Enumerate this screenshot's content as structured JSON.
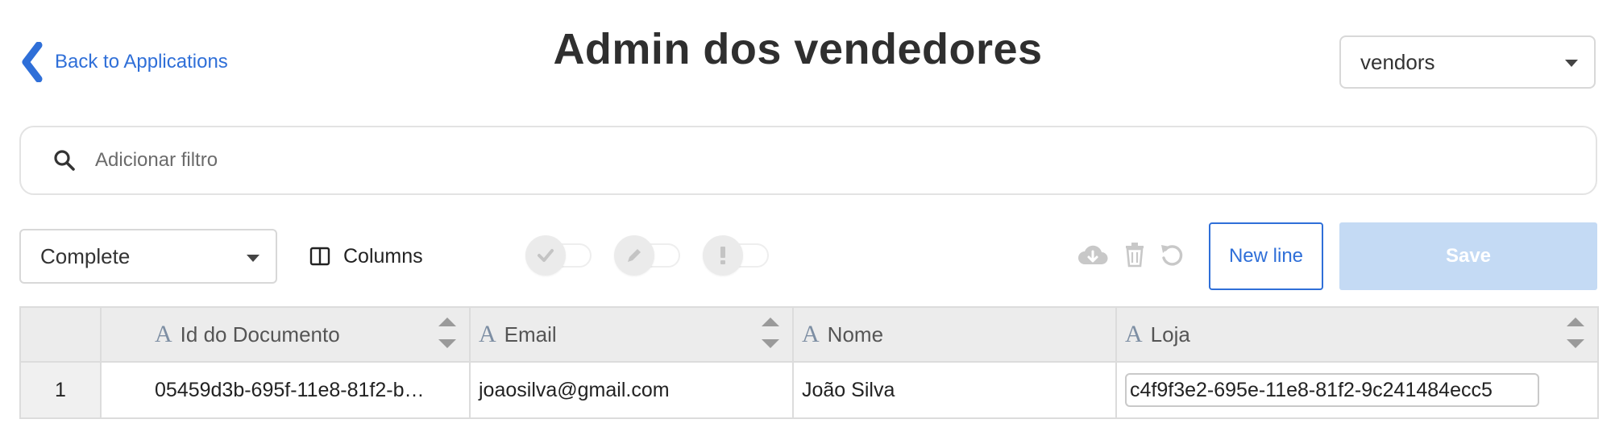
{
  "header": {
    "back_label": "Back to Applications",
    "title": "Admin dos vendedores",
    "app_select": {
      "value": "vendors"
    }
  },
  "filter": {
    "placeholder": "Adicionar filtro",
    "value": ""
  },
  "toolbar": {
    "view_select": {
      "value": "Complete"
    },
    "columns_label": "Columns",
    "toggles": [
      {
        "icon": "check-icon",
        "enabled": false
      },
      {
        "icon": "pencil-icon",
        "enabled": false
      },
      {
        "icon": "exclamation-icon",
        "enabled": false
      }
    ],
    "actions": [
      "cloud-download-icon",
      "trash-icon",
      "undo-icon"
    ],
    "new_line_label": "New line",
    "save_label": "Save"
  },
  "table": {
    "columns": [
      {
        "label": "Id do Documento",
        "type_icon": "A"
      },
      {
        "label": "Email",
        "type_icon": "A"
      },
      {
        "label": "Nome",
        "type_icon": "A"
      },
      {
        "label": "Loja",
        "type_icon": "A"
      }
    ],
    "rows": [
      {
        "index": "1",
        "id": "05459d3b-695f-11e8-81f2-b…",
        "email": "joaosilva@gmail.com",
        "nome": "João Silva",
        "loja": "c4f9f3e2-695e-11e8-81f2-9c241484ecc5"
      }
    ]
  },
  "colors": {
    "accent": "#2f6fd8",
    "save_disabled_bg": "#c4daf4",
    "header_bg": "#ececec"
  }
}
